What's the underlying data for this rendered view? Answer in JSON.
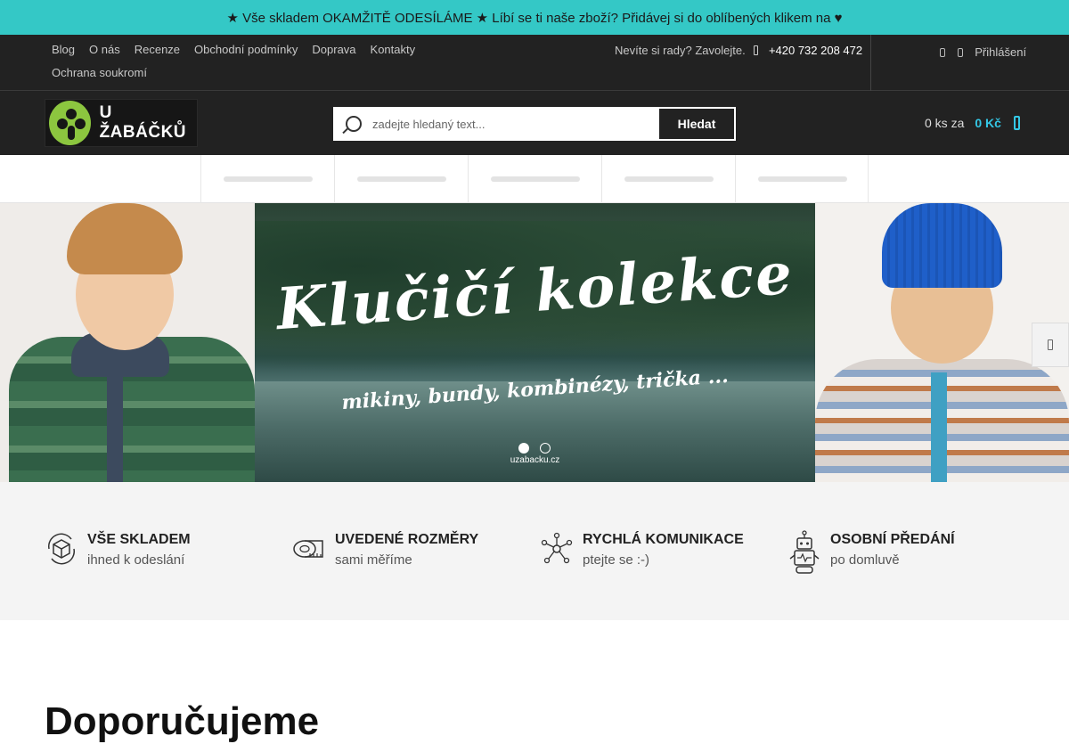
{
  "announcement": "★ Vše skladem OKAMŽITĚ ODESÍLÁME ★ Líbí se ti naše zboží? Přidávej si do oblíbených klikem na ♥",
  "topnav": [
    "Blog",
    " O nás",
    "Recenze",
    "Obchodní podmínky",
    " Doprava",
    "Kontakty",
    "Ochrana soukromí"
  ],
  "contact": {
    "text": "Nevíte si rady? Zavolejte.",
    "phone": "+420 732 208 472"
  },
  "account": {
    "login": "Přihlášení"
  },
  "logo": {
    "text": "U ŽABÁČKŮ",
    "color": "#8cc63f"
  },
  "search": {
    "placeholder": "zadejte hledaný text...",
    "button": "Hledat"
  },
  "cart": {
    "count": "0 ks za",
    "price": "0 Kč"
  },
  "hero": {
    "title": "Klučičí kolekce",
    "subtitle": "mikiny, bundy, kombinézy, trička ...",
    "watermark": "uzabacku.cz",
    "slides": 2,
    "active_slide": 1
  },
  "features": [
    {
      "icon": "box-cycle-icon",
      "title": "VŠE SKLADEM",
      "subtitle": "ihned k odeslání"
    },
    {
      "icon": "tape-measure-icon",
      "title": "UVEDENÉ ROZMĚRY",
      "subtitle": "sami měříme"
    },
    {
      "icon": "network-icon",
      "title": "RYCHLÁ KOMUNIKACE",
      "subtitle": "ptejte se :-)"
    },
    {
      "icon": "robot-icon",
      "title": "OSOBNÍ PŘEDÁNÍ",
      "subtitle": "po domluvě"
    }
  ],
  "section_title": "Doporučujeme",
  "colors": {
    "accent": "#34c8c6",
    "cart": "#34c8e6",
    "dark": "#222222"
  }
}
